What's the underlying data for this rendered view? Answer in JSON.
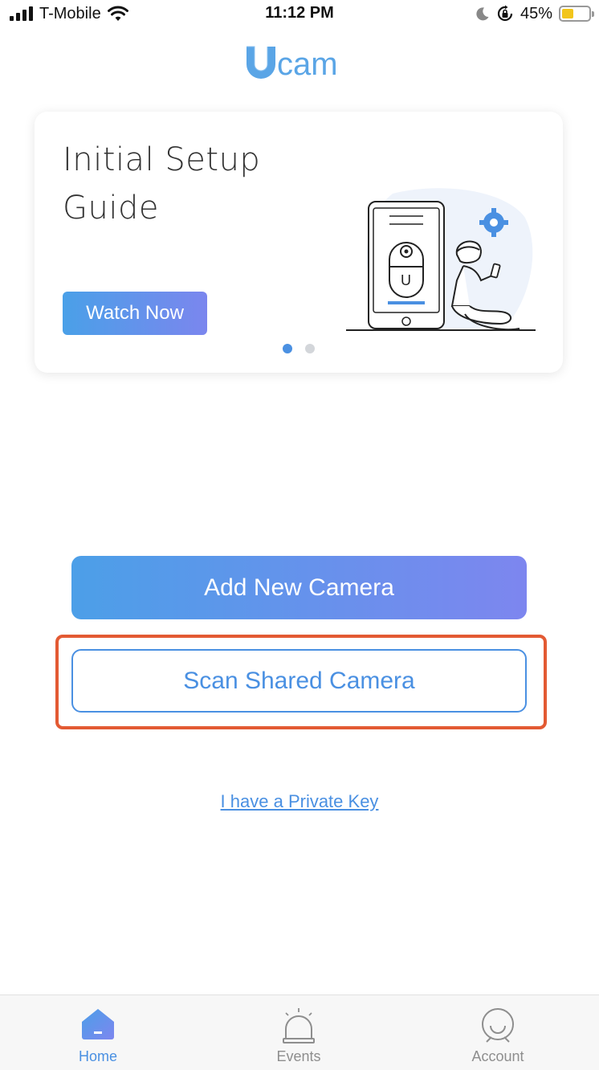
{
  "status_bar": {
    "carrier": "T-Mobile",
    "time": "11:12 PM",
    "battery_percent": "45%",
    "battery_level": 0.45
  },
  "logo": {
    "text": "Ucam",
    "color": "#5aa5e6"
  },
  "guide_card": {
    "title": "Initial Setup Guide",
    "watch_button_label": "Watch Now",
    "active_page": 1,
    "page_count": 2,
    "illustration_letter": "U"
  },
  "actions": {
    "add_camera_label": "Add New Camera",
    "scan_shared_label": "Scan Shared Camera",
    "private_key_link": "I have a Private Key",
    "highlight_color": "#e35a33"
  },
  "tab_bar": {
    "tabs": [
      {
        "label": "Home",
        "icon": "home-icon",
        "active": true
      },
      {
        "label": "Events",
        "icon": "alarm-light-icon",
        "active": false
      },
      {
        "label": "Account",
        "icon": "account-icon",
        "active": false
      }
    ],
    "active_color": "#4a90e2",
    "inactive_color": "#8e8e8e"
  }
}
